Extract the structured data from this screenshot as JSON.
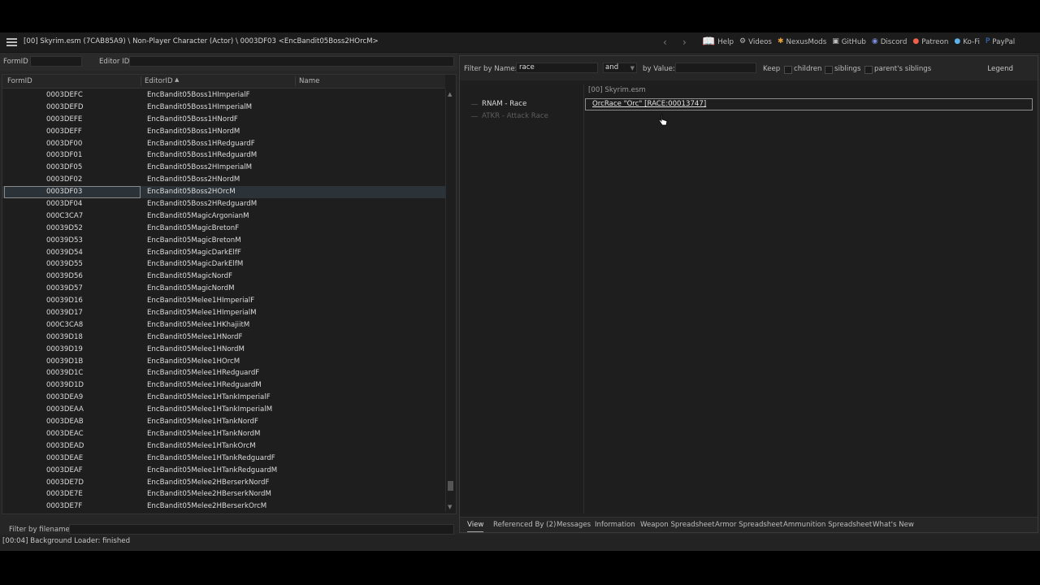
{
  "titlebar": {
    "path": "[00] Skyrim.esm (7CAB85A9) \\ Non-Player Character (Actor) \\ 0003DF03 <EncBandit05Boss2HOrcM>",
    "back_arrow": "‹",
    "forward_arrow": "›",
    "links": [
      {
        "label": "Help",
        "icon": "book-icon"
      },
      {
        "label": "Videos",
        "icon": "videos-icon"
      },
      {
        "label": "NexusMods",
        "icon": "nexusmods-icon"
      },
      {
        "label": "GitHub",
        "icon": "github-icon"
      },
      {
        "label": "Discord",
        "icon": "discord-icon"
      },
      {
        "label": "Patreon",
        "icon": "patreon-icon"
      },
      {
        "label": "Ko-Fi",
        "icon": "kofi-icon"
      },
      {
        "label": "PayPal",
        "icon": "paypal-icon"
      }
    ]
  },
  "left": {
    "formid_label": "FormID",
    "formid_value": "",
    "editorid_label": "Editor ID",
    "editorid_value": "",
    "columns": [
      "FormID",
      "EditorID",
      "Name"
    ],
    "sort_arrow": "▲",
    "selected_index": 8,
    "rows": [
      [
        "0003DEFC",
        "EncBandit05Boss1HImperialF"
      ],
      [
        "0003DEFD",
        "EncBandit05Boss1HImperialM"
      ],
      [
        "0003DEFE",
        "EncBandit05Boss1HNordF"
      ],
      [
        "0003DEFF",
        "EncBandit05Boss1HNordM"
      ],
      [
        "0003DF00",
        "EncBandit05Boss1HRedguardF"
      ],
      [
        "0003DF01",
        "EncBandit05Boss1HRedguardM"
      ],
      [
        "0003DF05",
        "EncBandit05Boss2HImperialM"
      ],
      [
        "0003DF02",
        "EncBandit05Boss2HNordM"
      ],
      [
        "0003DF03",
        "EncBandit05Boss2HOrcM"
      ],
      [
        "0003DF04",
        "EncBandit05Boss2HRedguardM"
      ],
      [
        "000C3CA7",
        "EncBandit05MagicArgonianM"
      ],
      [
        "00039D52",
        "EncBandit05MagicBretonF"
      ],
      [
        "00039D53",
        "EncBandit05MagicBretonM"
      ],
      [
        "00039D54",
        "EncBandit05MagicDarkElfF"
      ],
      [
        "00039D55",
        "EncBandit05MagicDarkElfM"
      ],
      [
        "00039D56",
        "EncBandit05MagicNordF"
      ],
      [
        "00039D57",
        "EncBandit05MagicNordM"
      ],
      [
        "00039D16",
        "EncBandit05Melee1HImperialF"
      ],
      [
        "00039D17",
        "EncBandit05Melee1HImperialM"
      ],
      [
        "000C3CA8",
        "EncBandit05Melee1HKhajiitM"
      ],
      [
        "00039D18",
        "EncBandit05Melee1HNordF"
      ],
      [
        "00039D19",
        "EncBandit05Melee1HNordM"
      ],
      [
        "00039D1B",
        "EncBandit05Melee1HOrcM"
      ],
      [
        "00039D1C",
        "EncBandit05Melee1HRedguardF"
      ],
      [
        "00039D1D",
        "EncBandit05Melee1HRedguardM"
      ],
      [
        "0003DEA9",
        "EncBandit05Melee1HTankImperialF"
      ],
      [
        "0003DEAA",
        "EncBandit05Melee1HTankImperialM"
      ],
      [
        "0003DEAB",
        "EncBandit05Melee1HTankNordF"
      ],
      [
        "0003DEAC",
        "EncBandit05Melee1HTankNordM"
      ],
      [
        "0003DEAD",
        "EncBandit05Melee1HTankOrcM"
      ],
      [
        "0003DEAE",
        "EncBandit05Melee1HTankRedguardF"
      ],
      [
        "0003DEAF",
        "EncBandit05Melee1HTankRedguardM"
      ],
      [
        "0003DE7D",
        "EncBandit05Melee2HBerserkNordF"
      ],
      [
        "0003DE7E",
        "EncBandit05Melee2HBerserkNordM"
      ],
      [
        "0003DE7F",
        "EncBandit05Melee2HBerserkOrcM"
      ]
    ],
    "filter_filename_label": "Filter by filename:",
    "filter_filename_value": ""
  },
  "right": {
    "filter_name_label": "Filter by Name:",
    "filter_name_value": "race",
    "operator_value": "and",
    "by_value_label": "by Value:",
    "by_value_value": "",
    "keep_label": "Keep",
    "children_label": "children",
    "siblings_label": "siblings",
    "parents_siblings_label": "parent's siblings",
    "legend_label": "Legend",
    "column_header": "[00] Skyrim.esm",
    "records": [
      {
        "name": "RNAM - Race",
        "value": "OrcRace \"Orc\" [RACE:00013747]"
      },
      {
        "name": "ATKR - Attack Race",
        "value": ""
      }
    ],
    "tabs": [
      "View",
      "Referenced By (2)",
      "Messages",
      "Information",
      "Weapon Spreadsheet",
      "Armor Spreadsheet",
      "Ammunition Spreadsheet",
      "What's New"
    ],
    "active_tab": "View"
  },
  "status": {
    "text": "[00:04] Background Loader: finished"
  }
}
